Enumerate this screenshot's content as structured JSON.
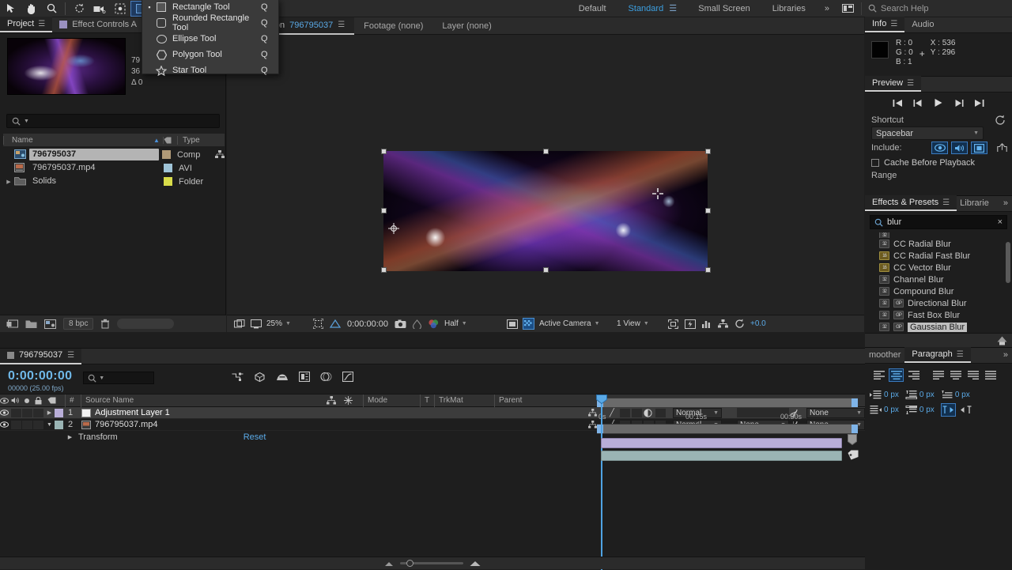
{
  "app": {
    "toolbar": {
      "tools": [
        {
          "name": "selection-tool",
          "glyph": "▶"
        },
        {
          "name": "hand-tool",
          "glyph": "✋"
        },
        {
          "name": "zoom-tool",
          "glyph": "⚲"
        },
        {
          "name": "rotation-tool",
          "glyph": "↻"
        },
        {
          "name": "camera-tool",
          "glyph": "Ἲ5"
        },
        {
          "name": "pan-behind-tool",
          "glyph": "✥"
        },
        {
          "name": "shape-tool",
          "glyph": "■"
        }
      ],
      "workspaces": [
        "Default",
        "Standard",
        "Small Screen",
        "Libraries"
      ],
      "active_workspace": "Standard",
      "overflow_label": "»",
      "search_placeholder": "Search Help"
    },
    "tool_menu": {
      "items": [
        {
          "label": "Rectangle Tool",
          "key": "Q",
          "shape": "rect",
          "checked": true
        },
        {
          "label": "Rounded Rectangle Tool",
          "key": "Q",
          "shape": "round-rect",
          "checked": false
        },
        {
          "label": "Ellipse Tool",
          "key": "Q",
          "shape": "ellipse",
          "checked": false
        },
        {
          "label": "Polygon Tool",
          "key": "Q",
          "shape": "polygon",
          "checked": false
        },
        {
          "label": "Star Tool",
          "key": "Q",
          "shape": "star",
          "checked": false
        }
      ]
    }
  },
  "project_panel": {
    "tabs": [
      {
        "label": "Project",
        "selected": true
      },
      {
        "label": "Effect Controls A",
        "selected": false
      }
    ],
    "preview_info": {
      "line1": "79",
      "line2": "36",
      "line3": "Δ 0"
    },
    "search_placeholder": "",
    "columns": [
      "Name",
      "Type"
    ],
    "items": [
      {
        "name": "796795037",
        "type": "Comp",
        "swatch": "#b09a78",
        "selected": true,
        "has_disclosure": false,
        "icon": "comp-icon"
      },
      {
        "name": "796795037.mp4",
        "type": "AVI",
        "swatch": "#9fc4d8",
        "selected": false,
        "has_disclosure": false,
        "icon": "footage-icon"
      },
      {
        "name": "Solids",
        "type": "Folder",
        "swatch": "#d8dc4a",
        "selected": false,
        "has_disclosure": true,
        "icon": "folder-icon"
      }
    ],
    "footer": {
      "bit_depth": "8 bpc"
    }
  },
  "composition_panel": {
    "tabs": [
      {
        "prefix": "Composition",
        "name": "796795037",
        "selected": true
      },
      {
        "prefix": "Footage (none)",
        "name": "",
        "selected": false
      },
      {
        "prefix": "Layer (none)",
        "name": "",
        "selected": false
      }
    ],
    "viewer_toolbar": {
      "magnification": "25%",
      "timecode": "0:00:00:00",
      "resolution": "Half",
      "camera": "Active Camera",
      "views": "1 View",
      "exposure": "+0.0"
    }
  },
  "info_panel": {
    "tabs": [
      {
        "label": "Info",
        "selected": true
      },
      {
        "label": "Audio",
        "selected": false
      }
    ],
    "r": "R : 0",
    "g": "G : 0",
    "b": "B : 1",
    "x": "X : 536",
    "y": "Y : 296",
    "swatch_color": "#020202"
  },
  "preview_panel": {
    "title": "Preview",
    "transport": [
      {
        "name": "first-frame-button",
        "glyph": "⏮"
      },
      {
        "name": "previous-frame-button",
        "glyph": "◀❘"
      },
      {
        "name": "play-button",
        "glyph": "▶"
      },
      {
        "name": "next-frame-button",
        "glyph": "❘▶"
      },
      {
        "name": "last-frame-button",
        "glyph": "⏭"
      }
    ],
    "shortcut_label": "Shortcut",
    "shortcut_value": "Spacebar",
    "include_label": "Include:",
    "include_toggles": [
      {
        "name": "video-toggle",
        "glyph": "◉"
      },
      {
        "name": "audio-toggle",
        "glyph": "◂))"
      },
      {
        "name": "overlays-toggle",
        "glyph": "⬚"
      }
    ],
    "cache_label": "Cache Before Playback",
    "cache_checked": false,
    "range_label": "Range"
  },
  "effects_panel": {
    "tabs": [
      {
        "label": "Effects & Presets",
        "selected": true
      },
      {
        "label": "Librarie",
        "selected": false
      }
    ],
    "overflow_label": "»",
    "search_value": "blur",
    "clear_label": "×",
    "effects": [
      {
        "label": "CC Radial Blur",
        "badges": 1,
        "highlighted": false
      },
      {
        "label": "CC Radial Fast Blur",
        "badges": 1,
        "highlighted": false,
        "yellow": true
      },
      {
        "label": "CC Vector Blur",
        "badges": 1,
        "highlighted": false,
        "yellow": true
      },
      {
        "label": "Channel Blur",
        "badges": 1,
        "highlighted": false
      },
      {
        "label": "Compound Blur",
        "badges": 1,
        "highlighted": false
      },
      {
        "label": "Directional Blur",
        "badges": 2,
        "highlighted": false
      },
      {
        "label": "Fast Box Blur",
        "badges": 2,
        "highlighted": false
      },
      {
        "label": "Gaussian Blur",
        "badges": 2,
        "highlighted": true
      }
    ]
  },
  "paragraph_panel": {
    "tabs": [
      {
        "label": "moother",
        "selected": false
      },
      {
        "label": "Paragraph",
        "selected": true
      }
    ],
    "overflow_label": "»",
    "align_buttons": [
      {
        "name": "align-left-button",
        "active": false
      },
      {
        "name": "align-center-button",
        "active": true
      },
      {
        "name": "align-right-button",
        "active": false
      },
      {
        "name": "justify-last-left-button",
        "active": false
      },
      {
        "name": "justify-last-center-button",
        "active": false
      },
      {
        "name": "justify-last-right-button",
        "active": false
      },
      {
        "name": "justify-all-button",
        "active": false
      }
    ],
    "fields": [
      {
        "name": "indent-left-margin",
        "value": "0 px"
      },
      {
        "name": "space-before-paragraph",
        "value": "0 px"
      },
      {
        "name": "space-after-paragraph",
        "value": "0 px"
      },
      {
        "name": "indent-right-margin",
        "value": "0 px"
      },
      {
        "name": "indent-first-line",
        "value": "0 px"
      }
    ],
    "direction_buttons": [
      {
        "name": "ltr-direction-button",
        "active": true
      },
      {
        "name": "rtl-direction-button",
        "active": false
      }
    ]
  },
  "timeline_panel": {
    "tab_label": "796795037",
    "timecode": "0:00:00:00",
    "frame_info": "00000 (25.00 fps)",
    "columns": [
      "#",
      "Source Name",
      "Mode",
      "T",
      "TrkMat",
      "Parent"
    ],
    "layers": [
      {
        "index": "1",
        "name": "Adjustment Layer 1",
        "color": "#b9aed8",
        "selected": true,
        "expanded": false,
        "mode": "Normal",
        "trkmat": "",
        "parent": "None",
        "icon": "solid-icon"
      },
      {
        "index": "2",
        "name": "796795037.mp4",
        "color": "#9ab4b4",
        "selected": false,
        "expanded": true,
        "mode": "Normal",
        "trkmat": "None",
        "parent": "None",
        "icon": "footage-icon"
      }
    ],
    "transform_row": {
      "label": "Transform",
      "reset_label": "Reset"
    },
    "ruler_labels": [
      {
        "text": "0s",
        "pos": 0
      },
      {
        "text": "00:15s",
        "pos": 120
      },
      {
        "text": "00:30s",
        "pos": 240
      }
    ]
  }
}
